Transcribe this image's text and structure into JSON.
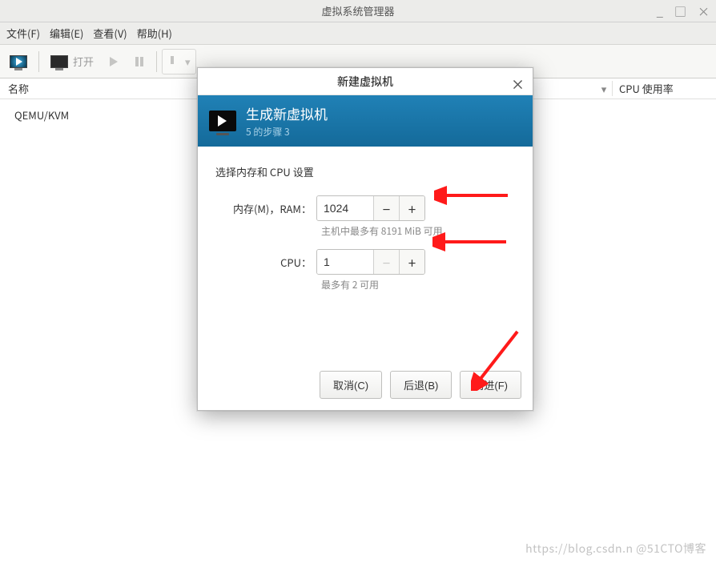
{
  "window": {
    "title": "虚拟系统管理器",
    "controls": {
      "min": "_",
      "max": "□",
      "close": "×"
    }
  },
  "menubar": {
    "file": "文件(F)",
    "edit": "编辑(E)",
    "view": "查看(V)",
    "help": "帮助(H)"
  },
  "toolbar": {
    "open_label": "打开"
  },
  "columns": {
    "name": "名称",
    "cpu": "CPU 使用率",
    "arrow": "▾"
  },
  "list": {
    "hypervisor": "QEMU/KVM"
  },
  "dialog": {
    "title": "新建虚拟机",
    "close": "×",
    "header_title": "生成新虚拟机",
    "header_sub": "5 的步骤 3",
    "section_label": "选择内存和 CPU 设置",
    "memory_label": "内存(M)，RAM：",
    "memory_value": "1024",
    "memory_hint": "主机中最多有 8191 MiB 可用",
    "cpu_label": "CPU：",
    "cpu_value": "1",
    "cpu_hint": "最多有 2 可用",
    "minus": "−",
    "plus": "+",
    "cancel": "取消(C)",
    "back": "后退(B)",
    "forward": "前进(F)"
  },
  "watermark": "https://blog.csdn.n @51CTO博客"
}
